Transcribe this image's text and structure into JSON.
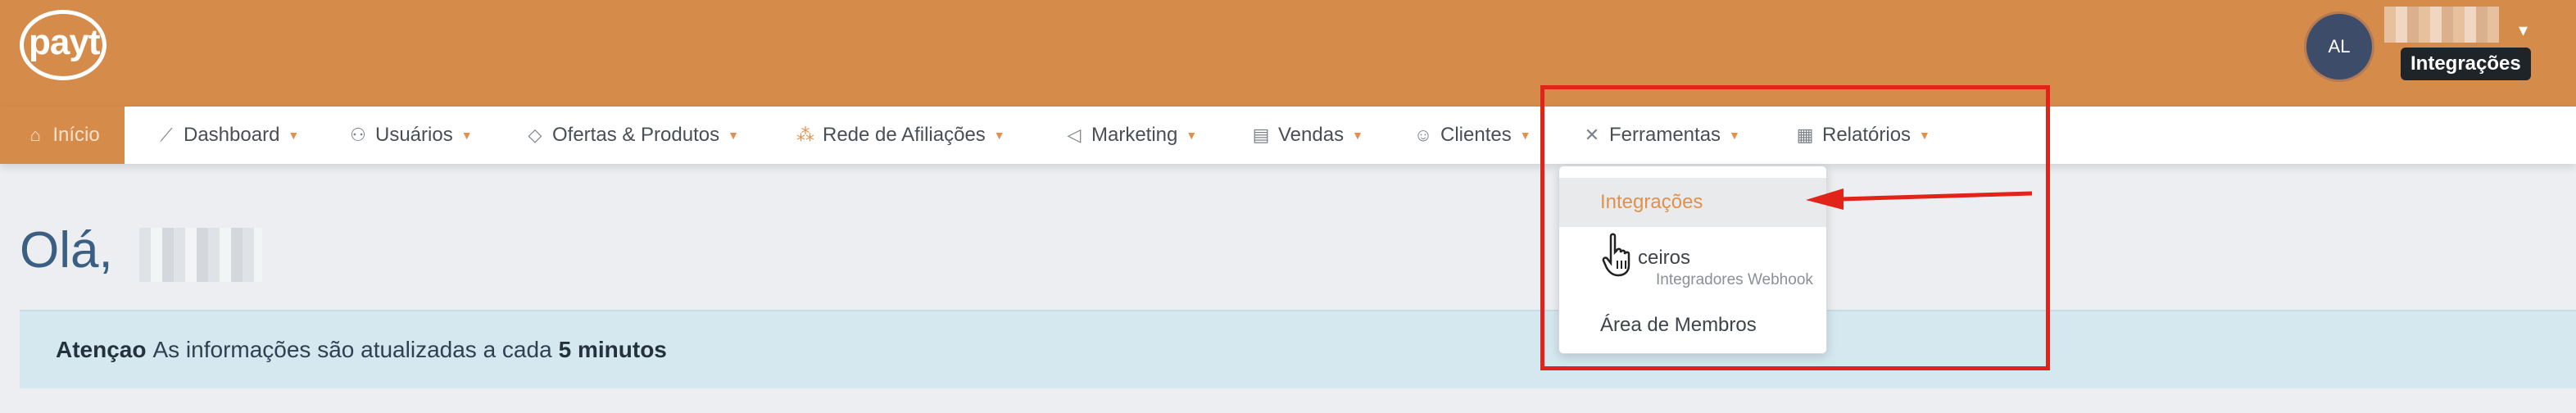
{
  "header": {
    "logo_text": "payt",
    "avatar_initials": "AL",
    "tooltip": "Integrações"
  },
  "nav": {
    "items": [
      {
        "label": "Início",
        "icon": "home-icon"
      },
      {
        "label": "Dashboard",
        "icon": "chart-icon"
      },
      {
        "label": "Usuários",
        "icon": "users-icon"
      },
      {
        "label": "Ofertas & Produtos",
        "icon": "tag-icon"
      },
      {
        "label": "Rede de Afiliações",
        "icon": "network-icon"
      },
      {
        "label": "Marketing",
        "icon": "megaphone-icon"
      },
      {
        "label": "Vendas",
        "icon": "list-icon"
      },
      {
        "label": "Clientes",
        "icon": "user-icon"
      },
      {
        "label": "Ferramentas",
        "icon": "tools-icon"
      },
      {
        "label": "Relatórios",
        "icon": "report-icon"
      }
    ]
  },
  "dropdown": {
    "items": [
      {
        "label": "Integrações"
      },
      {
        "label": "ceiros",
        "sublabel": "Integradores Webhook"
      },
      {
        "label": "Área de Membros"
      }
    ]
  },
  "main": {
    "greeting": "Olá,",
    "alert": {
      "strong": "Atençao",
      "text": "As informações são atualizadas a cada",
      "emphasis": "5 minutos"
    }
  },
  "colors": {
    "brand": "#d58b4a",
    "annotation": "#e2231a",
    "alert_bg": "#d5e7ef"
  }
}
